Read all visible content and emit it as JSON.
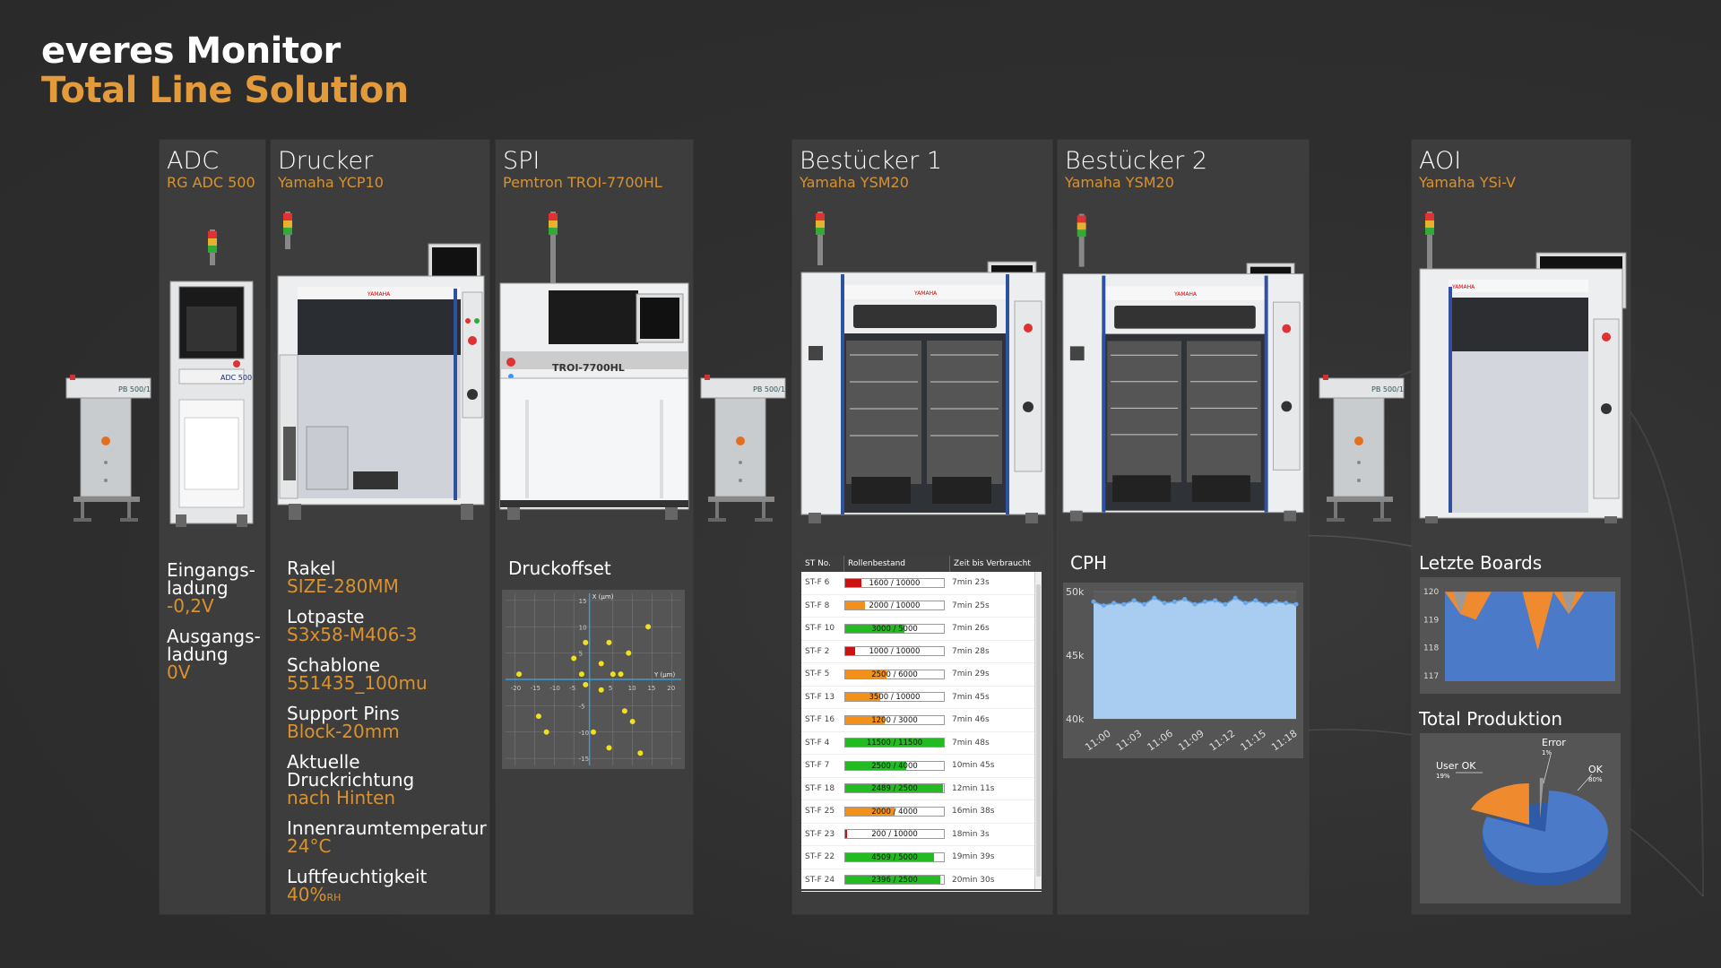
{
  "header": {
    "title": "everes Monitor",
    "subtitle": "Total Line Solution"
  },
  "columns": [
    {
      "name": "ADC",
      "model": "RG ADC 500"
    },
    {
      "name": "Drucker",
      "model": "Yamaha YCP10"
    },
    {
      "name": "SPI",
      "model": "Pemtron TROI-7700HL"
    },
    {
      "name": "Bestücker 1",
      "model": "Yamaha YSM20"
    },
    {
      "name": "Bestücker 2",
      "model": "Yamaha YSM20"
    },
    {
      "name": "AOI",
      "model": "Yamaha YSi-V"
    }
  ],
  "machine_labels": {
    "conveyor": "PB 500/1",
    "adc": "ADC 500",
    "spi": "TROI-7700HL",
    "brand": "YAMAHA"
  },
  "adc_params": [
    {
      "key1": "Eingangs-",
      "key2": "ladung",
      "value": "-0,2V"
    },
    {
      "key1": "Ausgangs-",
      "key2": "ladung",
      "value": "0V"
    }
  ],
  "printer_params": [
    {
      "key": "Rakel",
      "value": "SIZE-280MM"
    },
    {
      "key": "Lotpaste",
      "value": "S3x58-M406-3"
    },
    {
      "key": "Schablone",
      "value": "551435_100mu"
    },
    {
      "key": "Support Pins",
      "value": "Block-20mm"
    },
    {
      "key": "Aktuelle Druckrichtung",
      "value": "nach Hinten"
    },
    {
      "key": "Innenraumtemperatur",
      "value": "24°C"
    },
    {
      "key": "Luftfeuchtigkeit",
      "value": "40%",
      "unit": "RH"
    }
  ],
  "spi": {
    "label": "Druckoffset",
    "x_axis_label": "X (µm)",
    "y_axis_label": "Y (µm)",
    "h_ticks": [
      "-20",
      "-15",
      "-10",
      "-5",
      "5",
      "10",
      "15",
      "20"
    ],
    "v_ticks": [
      "15",
      "10",
      "5",
      "-5",
      "-10",
      "-15"
    ]
  },
  "feeder_table": {
    "headers": [
      "ST No.",
      "Rollenbestand",
      "Zeit bis Verbraucht"
    ],
    "rows": [
      {
        "st": "ST-F 6",
        "stock": "1600 / 10000",
        "frac": 0.16,
        "color": "#cc1111",
        "time": "7min 23s"
      },
      {
        "st": "ST-F 8",
        "stock": "2000 / 10000",
        "frac": 0.2,
        "color": "#f39019",
        "time": "7min 25s"
      },
      {
        "st": "ST-F 10",
        "stock": "3000 / 5000",
        "frac": 0.6,
        "color": "#22bb22",
        "time": "7min 26s"
      },
      {
        "st": "ST-F 2",
        "stock": "1000 / 10000",
        "frac": 0.1,
        "color": "#cc1111",
        "time": "7min 28s"
      },
      {
        "st": "ST-F 5",
        "stock": "2500 / 6000",
        "frac": 0.42,
        "color": "#f39019",
        "time": "7min 29s"
      },
      {
        "st": "ST-F 13",
        "stock": "3500 / 10000",
        "frac": 0.35,
        "color": "#f39019",
        "time": "7min 45s"
      },
      {
        "st": "ST-F 16",
        "stock": "1200 / 3000",
        "frac": 0.4,
        "color": "#f39019",
        "time": "7min 46s"
      },
      {
        "st": "ST-F 4",
        "stock": "11500 / 11500",
        "frac": 1.0,
        "color": "#22bb22",
        "time": "7min 48s"
      },
      {
        "st": "ST-F 7",
        "stock": "2500 / 4000",
        "frac": 0.62,
        "color": "#22bb22",
        "time": "10min 45s"
      },
      {
        "st": "ST-F 18",
        "stock": "2489 / 2500",
        "frac": 0.99,
        "color": "#22bb22",
        "time": "12min 11s"
      },
      {
        "st": "ST-F 25",
        "stock": "2000 / 4000",
        "frac": 0.5,
        "color": "#f39019",
        "time": "16min 38s"
      },
      {
        "st": "ST-F 23",
        "stock": "200 / 10000",
        "frac": 0.02,
        "color": "#cc1111",
        "time": "18min 3s"
      },
      {
        "st": "ST-F 22",
        "stock": "4509 / 5000",
        "frac": 0.9,
        "color": "#22bb22",
        "time": "19min 39s"
      },
      {
        "st": "ST-F 24",
        "stock": "2396 / 2500",
        "frac": 0.96,
        "color": "#22bb22",
        "time": "20min 30s"
      }
    ]
  },
  "cph": {
    "label": "CPH",
    "y_ticks": [
      "50k",
      "45k",
      "40k"
    ],
    "x_ticks": [
      "11:00",
      "11:03",
      "11:06",
      "11:09",
      "11:12",
      "11:15",
      "11:18"
    ]
  },
  "last_boards": {
    "label": "Letzte Boards",
    "y_ticks": [
      "120",
      "119",
      "118",
      "117"
    ]
  },
  "total_production": {
    "label": "Total Produktion",
    "slices": [
      {
        "name": "User OK",
        "pct": "19%"
      },
      {
        "name": "Error",
        "pct": "1%"
      },
      {
        "name": "OK",
        "pct": "80%"
      }
    ]
  },
  "chart_data": [
    {
      "type": "scatter",
      "title": "Druckoffset",
      "xlabel": "Y (µm)",
      "ylabel": "X (µm)",
      "xlim": [
        -22,
        22
      ],
      "ylim": [
        -16,
        16
      ],
      "points": [
        [
          -19,
          1
        ],
        [
          -14,
          -7
        ],
        [
          -12,
          -10
        ],
        [
          -5,
          4
        ],
        [
          -3,
          1
        ],
        [
          -2,
          7
        ],
        [
          -2,
          -1
        ],
        [
          0,
          -10
        ],
        [
          2,
          -2
        ],
        [
          2,
          3
        ],
        [
          4,
          7
        ],
        [
          4,
          -13
        ],
        [
          5,
          1
        ],
        [
          7,
          1
        ],
        [
          8,
          -6
        ],
        [
          9,
          5
        ],
        [
          10,
          -8
        ],
        [
          12,
          -14
        ],
        [
          14,
          10
        ]
      ]
    },
    {
      "type": "area",
      "title": "CPH",
      "ylim": [
        40000,
        50000
      ],
      "x": [
        "11:00",
        "11:01",
        "11:02",
        "11:03",
        "11:04",
        "11:05",
        "11:06",
        "11:07",
        "11:08",
        "11:09",
        "11:10",
        "11:11",
        "11:12",
        "11:13",
        "11:14",
        "11:15",
        "11:16",
        "11:17",
        "11:18",
        "11:19",
        "11:20"
      ],
      "values": [
        49200,
        48900,
        49100,
        49000,
        49300,
        49000,
        49500,
        49100,
        49200,
        49400,
        49000,
        49200,
        49300,
        49000,
        49500,
        49100,
        49300,
        49000,
        49200,
        49100,
        49000
      ]
    },
    {
      "type": "area",
      "title": "Letzte Boards",
      "ylim": [
        116.8,
        120.2
      ],
      "series": [
        {
          "name": "OK",
          "color": "#4a7ac8",
          "values": [
            120,
            120,
            119,
            120,
            120,
            120,
            117.9,
            120,
            120,
            120,
            120,
            120
          ]
        },
        {
          "name": "User OK",
          "color": "#ef8a2f",
          "values": [
            0,
            0.8,
            0,
            0,
            0,
            0,
            0,
            0,
            0.8,
            0,
            0,
            0
          ]
        }
      ]
    },
    {
      "type": "pie",
      "title": "Total Produktion",
      "categories": [
        "OK",
        "User OK",
        "Error"
      ],
      "values": [
        80,
        19,
        1
      ]
    }
  ]
}
